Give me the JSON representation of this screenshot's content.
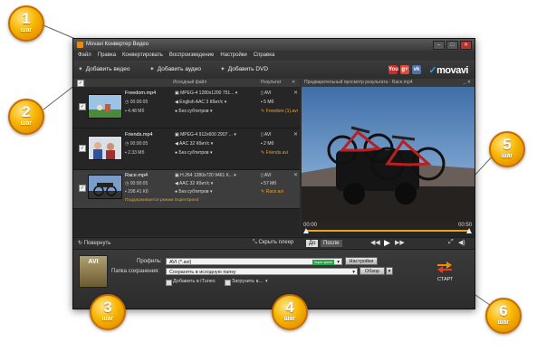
{
  "window": {
    "title": "Movavi Конвертер Видео",
    "min": "–",
    "max": "□",
    "close": "✕"
  },
  "menu": [
    "Файл",
    "Правка",
    "Конвертировать",
    "Воспроизведение",
    "Настройки",
    "Справка"
  ],
  "toolbar": {
    "add_video": "Добавить видео",
    "add_audio": "Добавить аудио",
    "add_dvd": "Добавить DVD",
    "social": [
      "You",
      "g+",
      "vk"
    ],
    "logo": "movavi"
  },
  "list_header": {
    "source": "Исходный файл",
    "result": "Результат"
  },
  "files": [
    {
      "name": "Freedom.mp4",
      "duration": "00:00:05",
      "size": "4.48 Мб",
      "video": "MPEG-4 1280x1200 751...",
      "audio": "English AAC 3 Кбит/с",
      "subs": "Без субтитров",
      "res_format": "AVI",
      "res_size": "5 Мб",
      "res_name": "Freedom (1).avi"
    },
    {
      "name": "Friends.mp4",
      "duration": "00:00:05",
      "size": "2.33 Мб",
      "video": "MPEG-4 912x600 2907 ...",
      "audio": "AAC 32 Кбит/с",
      "subs": "Без субтитров",
      "res_format": "AVI",
      "res_size": "2 Мб",
      "res_name": "Friends.avi"
    },
    {
      "name": "Race.mp4",
      "duration": "00:00:05",
      "size": "298.41 Кб",
      "video": "H.264 1280x720 9461 К...",
      "audio": "AAC 32 Кбит/с",
      "subs": "Без субтитров",
      "res_format": "AVI",
      "res_size": "57 Мб",
      "res_name": "Race.avi",
      "note": "Поддерживается режим SuperSpeed"
    }
  ],
  "preview": {
    "title": "Предварительный просмотр результата - Race.mp4",
    "time_start": "00:00",
    "time_end": "00:50"
  },
  "controls": {
    "rotate": "Повернуть",
    "hide_player": "Скрыть плеер",
    "before": "До",
    "after": "После"
  },
  "settings": {
    "profile_label": "Профиль:",
    "profile_value": "AVI (*.avi)",
    "profile_badge": "Super speed",
    "settings_button": "Настройки",
    "folder_label": "Папка сохранения:",
    "folder_value": "Сохранять в исходную папку",
    "browse_button": "Обзор",
    "add_itunes": "Добавить в iTunes",
    "upload": "Загрузить в...",
    "start": "СТАРТ",
    "format_icon": "AVI"
  },
  "steps": [
    {
      "num": "1",
      "label": "шаг"
    },
    {
      "num": "2",
      "label": "шаг"
    },
    {
      "num": "3",
      "label": "шаг"
    },
    {
      "num": "4",
      "label": "шаг"
    },
    {
      "num": "5",
      "label": "шаг"
    },
    {
      "num": "6",
      "label": "шаг"
    }
  ],
  "colors": {
    "accent": "#f0a020",
    "step_gold": "#f7b500",
    "window_bg": "#2b2b2b",
    "sky": "#5a87c0"
  }
}
